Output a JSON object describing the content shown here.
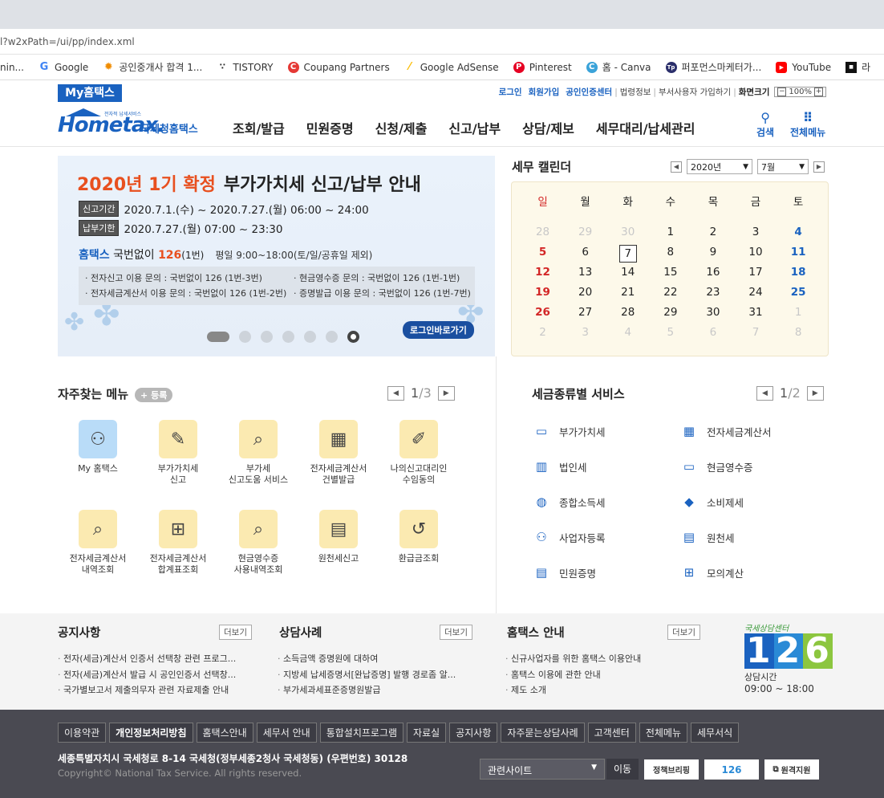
{
  "browser": {
    "url": "l?w2xPath=/ui/pp/index.xml",
    "bookmarks": [
      {
        "label": "nin...",
        "icon": "folder-icon"
      },
      {
        "label": "Google",
        "icon": "google-icon"
      },
      {
        "label": "공인중개사 합격 1...",
        "icon": "sun-icon"
      },
      {
        "label": "TISTORY",
        "icon": "tistory-icon"
      },
      {
        "label": "Coupang Partners",
        "icon": "coupang-icon"
      },
      {
        "label": "Google AdSense",
        "icon": "adsense-icon"
      },
      {
        "label": "Pinterest",
        "icon": "pinterest-icon"
      },
      {
        "label": "홈 - Canva",
        "icon": "canva-icon"
      },
      {
        "label": "퍼포먼스마케터가...",
        "icon": "tp-icon"
      },
      {
        "label": "YouTube",
        "icon": "youtube-icon"
      },
      {
        "label": "라",
        "icon": "app-icon"
      }
    ]
  },
  "utility": {
    "myhome": "My홈택스",
    "login": "로그인",
    "signup": "회원가입",
    "cert": "공인인증센터",
    "links": [
      "법령정보",
      "부서사용자 가입하기"
    ],
    "screen_size": "화면크기",
    "zoom": "100%"
  },
  "header": {
    "logo_tiny": "전자적 납세서비스",
    "logo_main": "Hometax.",
    "logo_sub": "국세청홈택스",
    "nav": [
      "조회/발급",
      "민원증명",
      "신청/제출",
      "신고/납부",
      "상담/제보",
      "세무대리/납세관리"
    ],
    "search": "검색",
    "all_menu": "전체메뉴"
  },
  "banner": {
    "title_highlight": "2020년 1기 확정",
    "title_rest": "부가가치세 신고/납부 안내",
    "period1_tag": "신고기간",
    "period1": "2020.7.1.(수) ~ 2020.7.27.(월) 06:00 ~ 24:00",
    "period2_tag": "납부기한",
    "period2": "2020.7.27.(월) 07:00 ~ 23:30",
    "phone_blue": "홈택스",
    "phone_mid": " 국번없이 ",
    "phone_num": "126",
    "phone_ext": "(1번)",
    "phone_hours": "평일 9:00~18:00(토/일/공휴일 제외)",
    "info": [
      "· 전자신고 이용 문의 : 국번없이 126 (1번-3번)",
      "· 현금영수증 문의 : 국번없이 126 (1번-1번)",
      "· 전자세금계산서 이용 문의 : 국번없이 126 (1번-2번)",
      "· 증명발급 이용 문의 : 국번없이 126 (1번-7번)"
    ],
    "login_btn": "로그인바로가기"
  },
  "calendar": {
    "title": "세무 캘린더",
    "year": "2020년",
    "month": "7월",
    "weekdays": [
      "일",
      "월",
      "화",
      "수",
      "목",
      "금",
      "토"
    ],
    "weeks": [
      [
        "28",
        "29",
        "30",
        "1",
        "2",
        "3",
        "4"
      ],
      [
        "5",
        "6",
        "7",
        "8",
        "9",
        "10",
        "11"
      ],
      [
        "12",
        "13",
        "14",
        "15",
        "16",
        "17",
        "18"
      ],
      [
        "19",
        "20",
        "21",
        "22",
        "23",
        "24",
        "25"
      ],
      [
        "26",
        "27",
        "28",
        "29",
        "30",
        "31",
        "1"
      ],
      [
        "2",
        "3",
        "4",
        "5",
        "6",
        "7",
        "8"
      ]
    ]
  },
  "favorites": {
    "title": "자주찾는 메뉴",
    "register": "+ 등록",
    "page_cur": "1",
    "page_total": "/3",
    "items": [
      {
        "label": "My 홈택스",
        "icon": "person-icon"
      },
      {
        "label": "부가가치세\n신고",
        "icon": "vat-icon"
      },
      {
        "label": "부가세\n신고도움 서비스",
        "icon": "search-doc-icon"
      },
      {
        "label": "전자세금계산서\n건별발급",
        "icon": "calculator-icon"
      },
      {
        "label": "나의신고대리인\n수임동의",
        "icon": "edit-doc-icon"
      },
      {
        "label": "전자세금계산서\n내역조회",
        "icon": "doc-search-icon"
      },
      {
        "label": "전자세금계산서\n합계표조회",
        "icon": "doc-add-icon"
      },
      {
        "label": "현금영수증\n사용내역조회",
        "icon": "cash-search-icon"
      },
      {
        "label": "원천세신고",
        "icon": "calendar-edit-icon"
      },
      {
        "label": "환급금조회",
        "icon": "refund-icon"
      }
    ]
  },
  "tax_services": {
    "title": "세금종류별 서비스",
    "page_cur": "1",
    "page_total": "/2",
    "items": [
      {
        "label": "부가가치세",
        "icon": "vat-icon"
      },
      {
        "label": "전자세금계산서",
        "icon": "calculator-icon"
      },
      {
        "label": "법인세",
        "icon": "building-icon"
      },
      {
        "label": "현금영수증",
        "icon": "cash-icon"
      },
      {
        "label": "종합소득세",
        "icon": "money-bag-icon"
      },
      {
        "label": "소비제세",
        "icon": "diamond-icon"
      },
      {
        "label": "사업자등록",
        "icon": "person-icon"
      },
      {
        "label": "원천세",
        "icon": "tax-doc-icon"
      },
      {
        "label": "민원증명",
        "icon": "document-icon"
      },
      {
        "label": "모의계산",
        "icon": "calc-icon"
      }
    ]
  },
  "notices": {
    "more": "더보기",
    "columns": [
      {
        "title": "공지사항",
        "items": [
          "전자(세금)계산서 인증서 선택창 관련 프로그...",
          "전자(세금)계산서 발급 시 공인인증서 선택창...",
          "국가별보고서 제출의무자 관련 자료제출 안내"
        ]
      },
      {
        "title": "상담사례",
        "items": [
          "소득금액 증명원에 대하여",
          "지방세 납세증명서[완납증명] 발행 경로좀 알...",
          "부가세과세표준증명원발급"
        ]
      },
      {
        "title": "홈택스 안내",
        "items": [
          "신규사업자를 위한 홈택스 이용안내",
          "홈택스 이용에 관한 안내",
          "제도 소개"
        ]
      }
    ],
    "center_label": "국세상담센터",
    "center_digits": [
      "1",
      "2",
      "6"
    ],
    "hours_label": "상담시간",
    "hours": "09:00 ~ 18:00"
  },
  "footer": {
    "links": [
      "이용약관",
      "개인정보처리방침",
      "홈택스안내",
      "세무서 안내",
      "통합설치프로그램",
      "자료실",
      "공지사항",
      "자주묻는상담사례",
      "고객센터",
      "전체메뉴",
      "세무서식"
    ],
    "address": "세종특별자치시 국세청로 8-14 국세청(정부세종2청사 국세청동) (우편번호) 30128",
    "copyright": "Copyright© National Tax Service. All rights reserved.",
    "related_sites": "관련사이트",
    "go": "이동",
    "badge1": "정책브리핑",
    "badge2": "126",
    "badge3": "원격지원"
  },
  "colors": {
    "brand_blue": "#1a62c0",
    "highlight_orange": "#e8501f",
    "sunday_red": "#d32626",
    "footer_bg": "#4a4a52"
  }
}
